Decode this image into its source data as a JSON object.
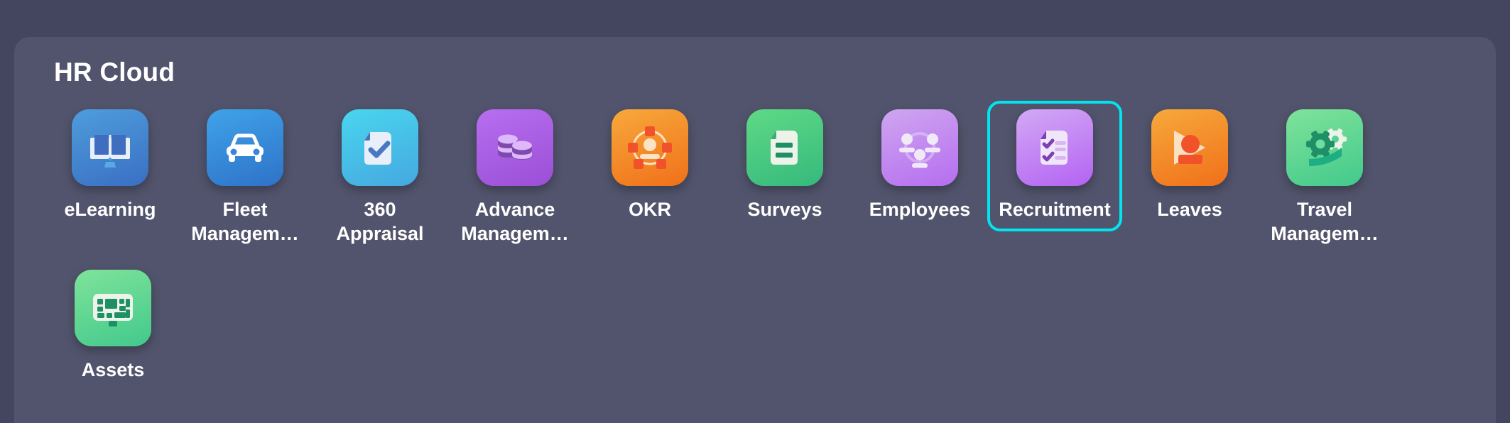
{
  "window": {
    "background_color": "#43465e",
    "panel_color": "#51546c"
  },
  "panel": {
    "title": "HR Cloud",
    "selection_color": "#00e5ee",
    "selected_app": "Recruitment"
  },
  "apps": [
    {
      "label": "eLearning",
      "icon": "book-laptop-icon",
      "color_start": "#4e9ddb",
      "color_end": "#3a6fc4",
      "selected": false
    },
    {
      "label": "Fleet\nManagem…",
      "full_label": "Fleet Management",
      "icon": "car-icon",
      "color_start": "#3fa3e8",
      "color_end": "#2f72c9",
      "selected": false
    },
    {
      "label": "360\nAppraisal",
      "full_label": "360 Appraisal",
      "icon": "document-check-icon",
      "color_start": "#48d6ee",
      "color_end": "#46a8e0",
      "selected": false
    },
    {
      "label": "Advance\nManagem…",
      "full_label": "Advance Management",
      "icon": "coins-icon",
      "color_start": "#b martin",
      "color_end": "#9a4fd6",
      "selected": false
    },
    {
      "label": "OKR",
      "icon": "target-person-network-icon",
      "color_start": "#f7a93b",
      "color_end": "#f0701a",
      "selected": false
    },
    {
      "label": "Surveys",
      "icon": "survey-document-icon",
      "color_start": "#5fd986",
      "color_end": "#35b97c",
      "selected": false
    },
    {
      "label": "Employees",
      "icon": "people-group-icon",
      "color_start": "#cfa6f0",
      "color_end": "#b56ef0",
      "selected": false
    },
    {
      "label": "Recruitment",
      "icon": "checklist-document-icon",
      "color_start": "#d2a9f5",
      "color_end": "#b463f2",
      "selected": true
    },
    {
      "label": "Leaves",
      "icon": "flag-leave-icon",
      "color_start": "#f7a93b",
      "color_end": "#f0701a",
      "selected": false
    },
    {
      "label": "Travel\nManagem…",
      "full_label": "Travel Management",
      "icon": "gears-swoosh-icon",
      "color_start": "#7fe39a",
      "color_end": "#42c98c",
      "selected": false
    },
    {
      "label": "Assets",
      "icon": "monitor-blocks-icon",
      "color_start": "#7fe39a",
      "color_end": "#42c98c",
      "selected": false
    }
  ]
}
